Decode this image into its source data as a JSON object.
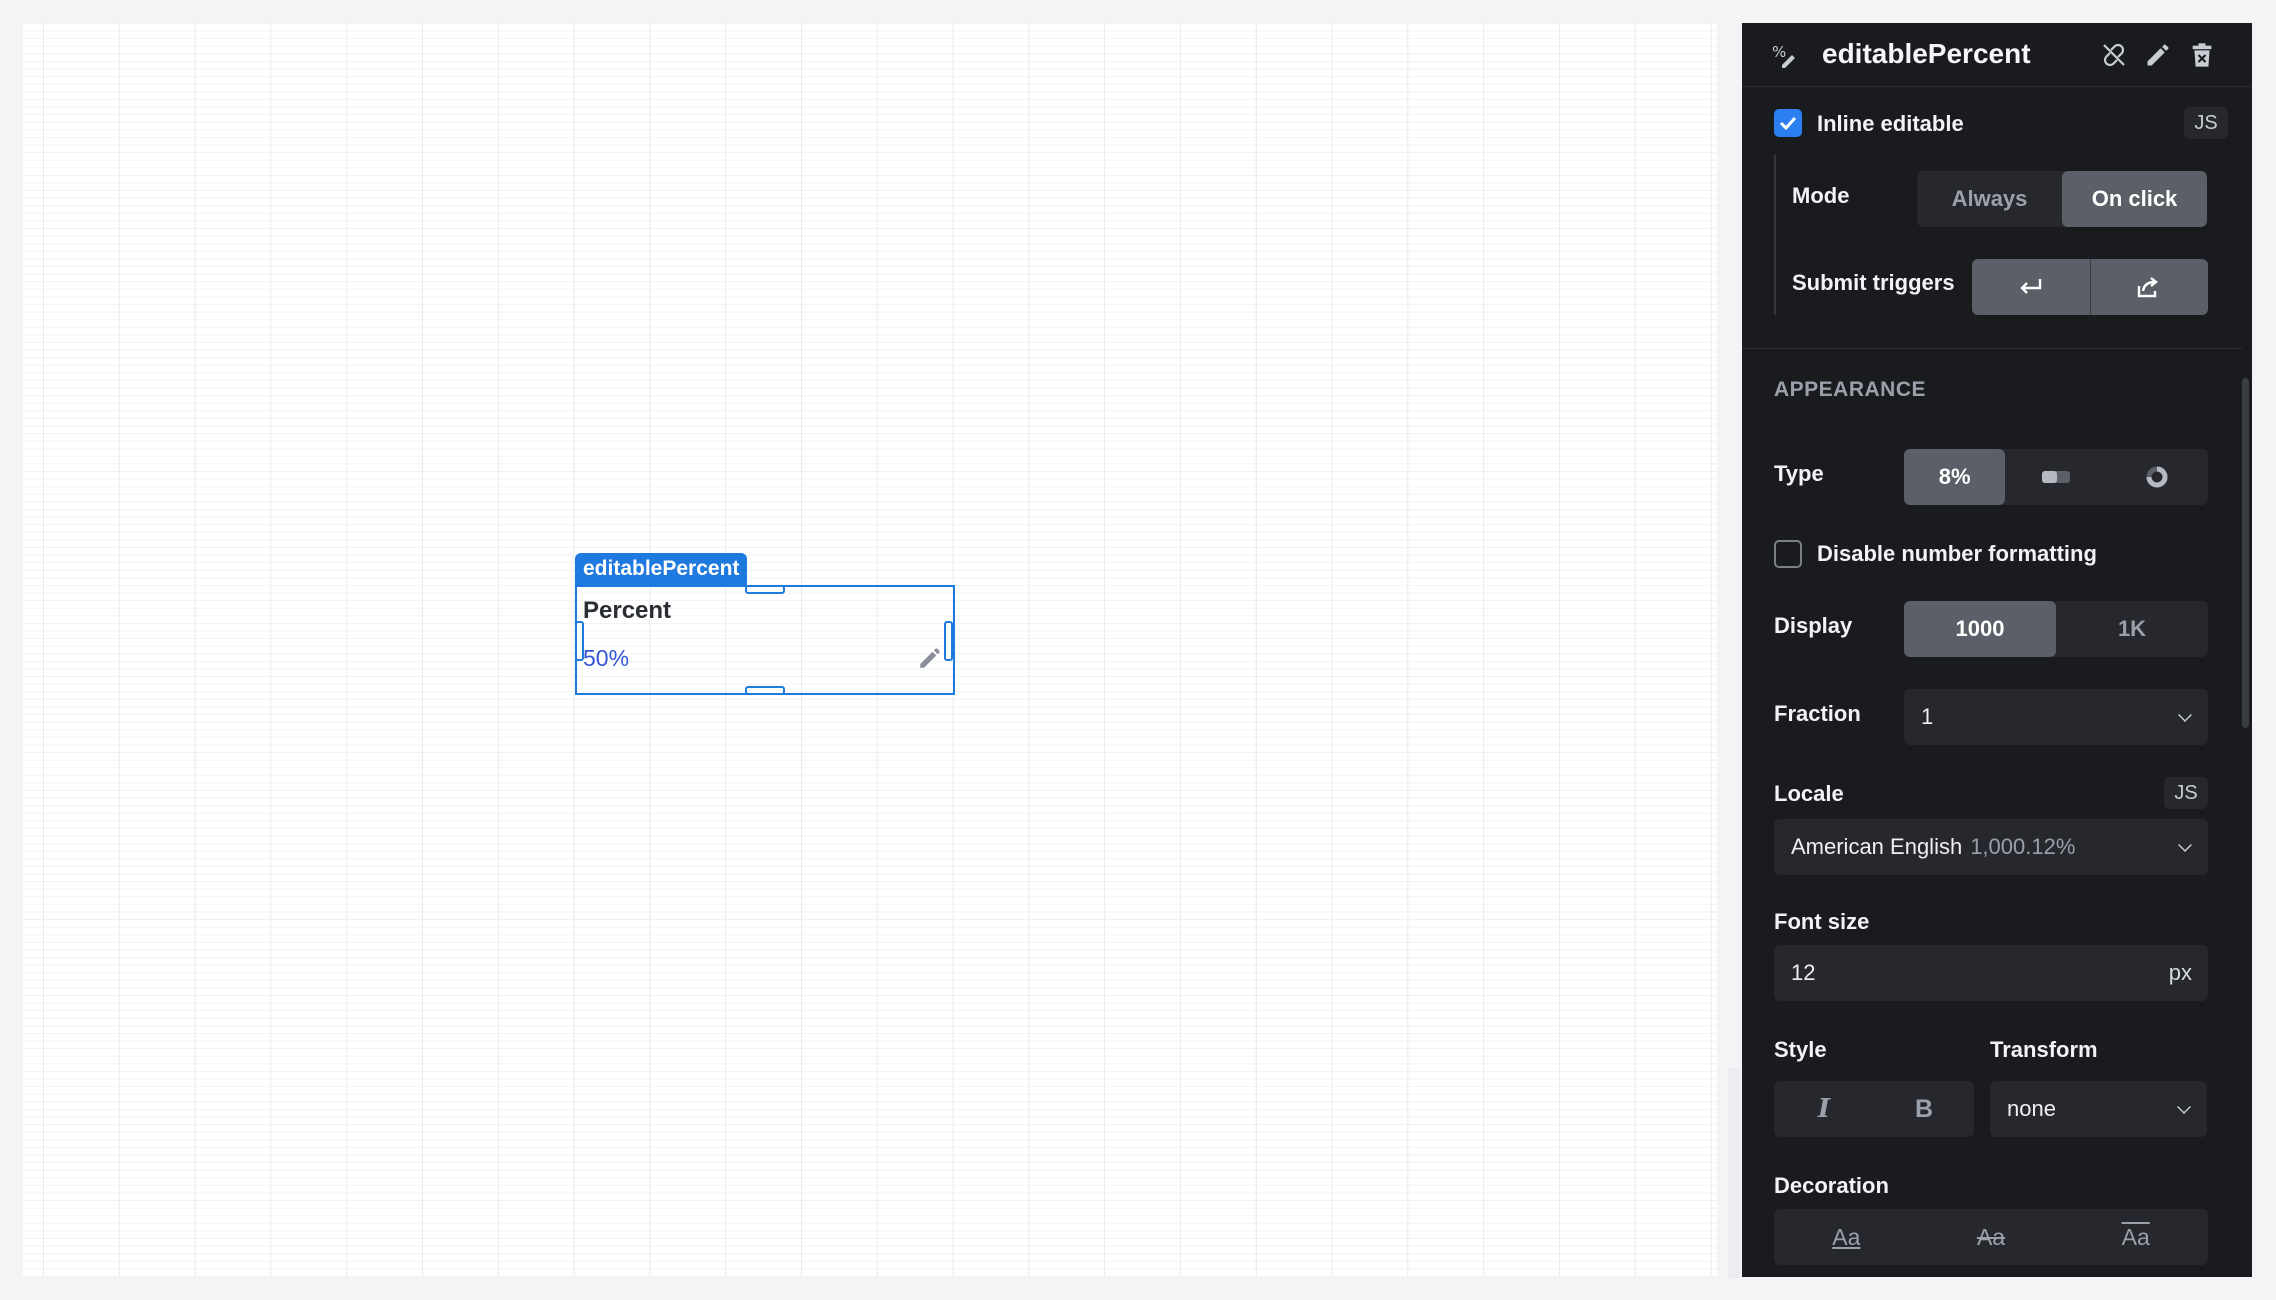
{
  "widget": {
    "tag": "editablePercent",
    "label": "Percent",
    "value": "50%"
  },
  "panel": {
    "title": "editablePercent",
    "header_icons": [
      "percent-edit-icon",
      "unlink-icon",
      "pencil-icon",
      "trash-icon"
    ],
    "inline_editable": {
      "label": "Inline editable",
      "checked": true,
      "js": "JS"
    },
    "mode": {
      "label": "Mode",
      "options": [
        "Always",
        "On click"
      ],
      "selected": "On click"
    },
    "submit_triggers": {
      "label": "Submit triggers",
      "icons": [
        "enter-key-icon",
        "share-out-icon"
      ]
    },
    "appearance": {
      "section": "APPEARANCE",
      "type": {
        "label": "Type",
        "options": [
          "8%",
          "progress-bar-icon",
          "donut-icon"
        ],
        "selected": "8%",
        "first_label": "8%"
      },
      "disable_formatting": {
        "label": "Disable number formatting",
        "checked": false
      },
      "display": {
        "label": "Display",
        "options": [
          "1000",
          "1K"
        ],
        "selected": "1000"
      },
      "fraction": {
        "label": "Fraction",
        "value": "1"
      },
      "locale": {
        "label": "Locale",
        "js": "JS",
        "value": "American English",
        "example": "1,000.12%"
      },
      "font_size": {
        "label": "Font size",
        "value": "12",
        "unit": "px"
      },
      "style": {
        "label": "Style",
        "options": [
          "I",
          "B"
        ]
      },
      "transform": {
        "label": "Transform",
        "value": "none"
      },
      "decoration": {
        "label": "Decoration",
        "options": [
          "Aa",
          "Aa",
          "Aa"
        ]
      }
    }
  },
  "colors": {
    "accent": "#1f7ae0",
    "panel_bg": "#1a1b1f",
    "control_bg": "#26282d",
    "selected_bg": "#5b5f68",
    "checkbox_on": "#2b7ff0"
  }
}
